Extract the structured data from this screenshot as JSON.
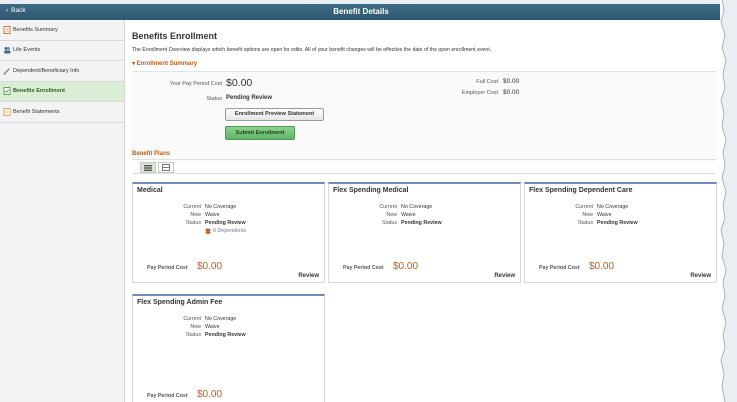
{
  "header": {
    "back_label": "Back",
    "title": "Benefit Details"
  },
  "sidebar": {
    "items": [
      {
        "label": "Benefits Summary",
        "icon": "summary-icon"
      },
      {
        "label": "Life Events",
        "icon": "people-icon"
      },
      {
        "label": "Dependent/Beneficiary Info",
        "icon": "dependent-icon"
      },
      {
        "label": "Benefits Enrollment",
        "icon": "enrollment-icon",
        "active": true
      },
      {
        "label": "Benefit Statements",
        "icon": "statement-icon"
      }
    ]
  },
  "main": {
    "title": "Benefits Enrollment",
    "intro": "The Enrollment Overview displays which benefit options are open for edits. All of your benefit changes will be effective the date of the open enrollment event.",
    "summary": {
      "toggle_label": "Enrollment Summary",
      "pay_period_cost_label": "Your Pay Period Cost",
      "pay_period_cost_value": "$0.00",
      "status_label": "Status",
      "status_value": "Pending Review",
      "full_cost_label": "Full Cost",
      "full_cost_value": "$0.00",
      "employer_cost_label": "Employer Cost",
      "employer_cost_value": "$0.00",
      "preview_button": "Enrollment Preview Statement",
      "submit_button": "Submit Enrollment"
    },
    "plans": {
      "title": "Benefit Plans",
      "current_label": "Current",
      "new_label": "New",
      "status_label": "Status",
      "ppc_label": "Pay Period Cost",
      "review_label": "Review",
      "cards": [
        {
          "title": "Medical",
          "current": "No Coverage",
          "new": "Waive",
          "status": "Pending Review",
          "dependents": "0 Dependents",
          "cost": "$0.00"
        },
        {
          "title": "Flex Spending Medical",
          "current": "No Coverage",
          "new": "Waive",
          "status": "Pending Review",
          "cost": "$0.00"
        },
        {
          "title": "Flex Spending Dependent Care",
          "current": "No Coverage",
          "new": "Waive",
          "status": "Pending Review",
          "cost": "$0.00"
        },
        {
          "title": "Flex Spending Admin Fee",
          "current": "No Coverage",
          "new": "Waive",
          "status": "Pending Review",
          "cost": "$0.00"
        }
      ]
    }
  },
  "colors": {
    "header": "#2e5670",
    "accent": "#c05c15",
    "active_bg": "#d9eed4",
    "card_border": "#6e8cb8",
    "submit": "#6cbf70"
  }
}
